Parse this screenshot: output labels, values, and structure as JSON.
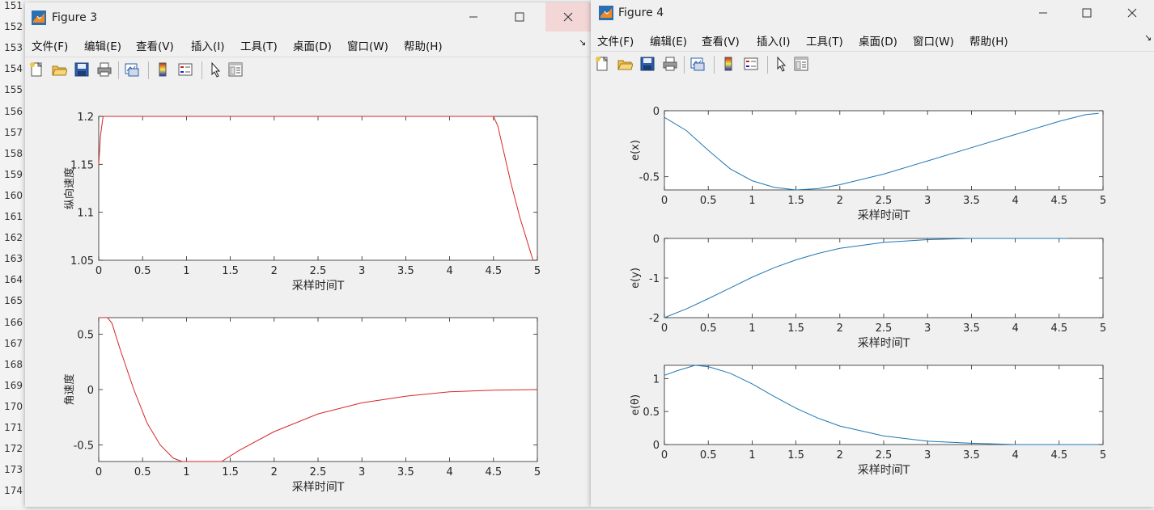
{
  "editor": {
    "line_numbers": [
      "151",
      "152",
      "153",
      "154",
      "155",
      "156",
      "157",
      "158",
      "159",
      "160",
      "161",
      "162",
      "163",
      "164",
      "165",
      "166",
      "167",
      "168",
      "169",
      "170",
      "171",
      "172",
      "173",
      "174"
    ]
  },
  "figure3": {
    "title": "Figure 3",
    "menu": [
      "文件(F)",
      "编辑(E)",
      "查看(V)",
      "插入(I)",
      "工具(T)",
      "桌面(D)",
      "窗口(W)",
      "帮助(H)"
    ],
    "toolbar_icons": [
      "new-figure-icon",
      "open-file-icon",
      "save-icon",
      "print-icon",
      "link-plot-icon",
      "insert-colorbar-icon",
      "insert-legend-icon",
      "pointer-icon",
      "property-inspector-icon"
    ],
    "chart_data": [
      {
        "type": "line",
        "xlabel": "采样时间T",
        "ylabel": "纵向速度",
        "xlim": [
          0,
          5
        ],
        "ylim": [
          1.05,
          1.2
        ],
        "xticks": [
          "0",
          "0.5",
          "1",
          "1.5",
          "2",
          "2.5",
          "3",
          "3.5",
          "4",
          "4.5",
          "5"
        ],
        "yticks": [
          "1.05",
          "1.1",
          "1.15",
          "1.2"
        ],
        "color": "#d62728",
        "series": [
          {
            "x": [
              0,
              0.02,
              0.05,
              0.1,
              1,
              2,
              3,
              4,
              4.5,
              4.55,
              4.6,
              4.7,
              4.8,
              4.9,
              4.95
            ],
            "y": [
              1.15,
              1.18,
              1.2,
              1.2,
              1.2,
              1.2,
              1.2,
              1.2,
              1.2,
              1.19,
              1.17,
              1.13,
              1.095,
              1.065,
              1.05
            ]
          }
        ]
      },
      {
        "type": "line",
        "xlabel": "采样时间T",
        "ylabel": "角速度",
        "xlim": [
          0,
          5
        ],
        "ylim": [
          -0.65,
          0.65
        ],
        "xticks": [
          "0",
          "0.5",
          "1",
          "1.5",
          "2",
          "2.5",
          "3",
          "3.5",
          "4",
          "4.5",
          "5"
        ],
        "yticks": [
          "-0.5",
          "0",
          "0.5"
        ],
        "color": "#d62728",
        "series": [
          {
            "x": [
              0,
              0.1,
              0.15,
              0.25,
              0.4,
              0.55,
              0.7,
              0.85,
              0.95,
              1.4,
              1.6,
              2,
              2.5,
              3,
              3.5,
              4,
              4.5,
              5
            ],
            "y": [
              0.65,
              0.65,
              0.6,
              0.35,
              0.0,
              -0.3,
              -0.5,
              -0.62,
              -0.65,
              -0.65,
              -0.55,
              -0.38,
              -0.22,
              -0.12,
              -0.06,
              -0.02,
              -0.005,
              0
            ]
          }
        ]
      }
    ]
  },
  "figure4": {
    "title": "Figure 4",
    "menu": [
      "文件(F)",
      "编辑(E)",
      "查看(V)",
      "插入(I)",
      "工具(T)",
      "桌面(D)",
      "窗口(W)",
      "帮助(H)"
    ],
    "toolbar_icons": [
      "new-figure-icon",
      "open-file-icon",
      "save-icon",
      "print-icon",
      "link-plot-icon",
      "insert-colorbar-icon",
      "insert-legend-icon",
      "pointer-icon",
      "property-inspector-icon"
    ],
    "chart_data": [
      {
        "type": "line",
        "xlabel": "采样时间T",
        "ylabel": "e(x)",
        "xlim": [
          0,
          5
        ],
        "ylim": [
          -0.6,
          0
        ],
        "xticks": [
          "0",
          "0.5",
          "1",
          "1.5",
          "2",
          "2.5",
          "3",
          "3.5",
          "4",
          "4.5",
          "5"
        ],
        "yticks": [
          "-0.5",
          "0"
        ],
        "color": "#1f77b4",
        "series": [
          {
            "x": [
              0,
              0.25,
              0.5,
              0.75,
              1,
              1.25,
              1.5,
              1.75,
              2,
              2.5,
              3,
              3.5,
              4,
              4.5,
              4.8,
              4.95
            ],
            "y": [
              -0.05,
              -0.15,
              -0.3,
              -0.44,
              -0.53,
              -0.58,
              -0.6,
              -0.59,
              -0.56,
              -0.48,
              -0.38,
              -0.28,
              -0.18,
              -0.08,
              -0.03,
              -0.02
            ]
          }
        ]
      },
      {
        "type": "line",
        "xlabel": "采样时间T",
        "ylabel": "e(y)",
        "xlim": [
          0,
          5
        ],
        "ylim": [
          -2,
          0
        ],
        "xticks": [
          "0",
          "0.5",
          "1",
          "1.5",
          "2",
          "2.5",
          "3",
          "3.5",
          "4",
          "4.5",
          "5"
        ],
        "yticks": [
          "-2",
          "-1",
          "0"
        ],
        "color": "#1f77b4",
        "series": [
          {
            "x": [
              0,
              0.25,
              0.5,
              0.75,
              1,
              1.25,
              1.5,
              1.75,
              2,
              2.5,
              3,
              3.5,
              4,
              4.6
            ],
            "y": [
              -2,
              -1.78,
              -1.52,
              -1.25,
              -0.98,
              -0.74,
              -0.54,
              -0.38,
              -0.25,
              -0.1,
              -0.03,
              0,
              0,
              0
            ]
          }
        ]
      },
      {
        "type": "line",
        "xlabel": "采样时间T",
        "ylabel": "e(θ)",
        "xlim": [
          0,
          5
        ],
        "ylim": [
          0,
          1.2
        ],
        "xticks": [
          "0",
          "0.5",
          "1",
          "1.5",
          "2",
          "2.5",
          "3",
          "3.5",
          "4",
          "4.5",
          "5"
        ],
        "yticks": [
          "0",
          "0.5",
          "1"
        ],
        "color": "#1f77b4",
        "series": [
          {
            "x": [
              0,
              0.15,
              0.35,
              0.5,
              0.75,
              1,
              1.25,
              1.5,
              1.75,
              2,
              2.5,
              3,
              3.5,
              4,
              4.5,
              4.95
            ],
            "y": [
              1.05,
              1.12,
              1.2,
              1.18,
              1.08,
              0.92,
              0.73,
              0.55,
              0.4,
              0.28,
              0.13,
              0.05,
              0.02,
              0.0,
              0.0,
              0.0
            ]
          }
        ]
      }
    ]
  }
}
